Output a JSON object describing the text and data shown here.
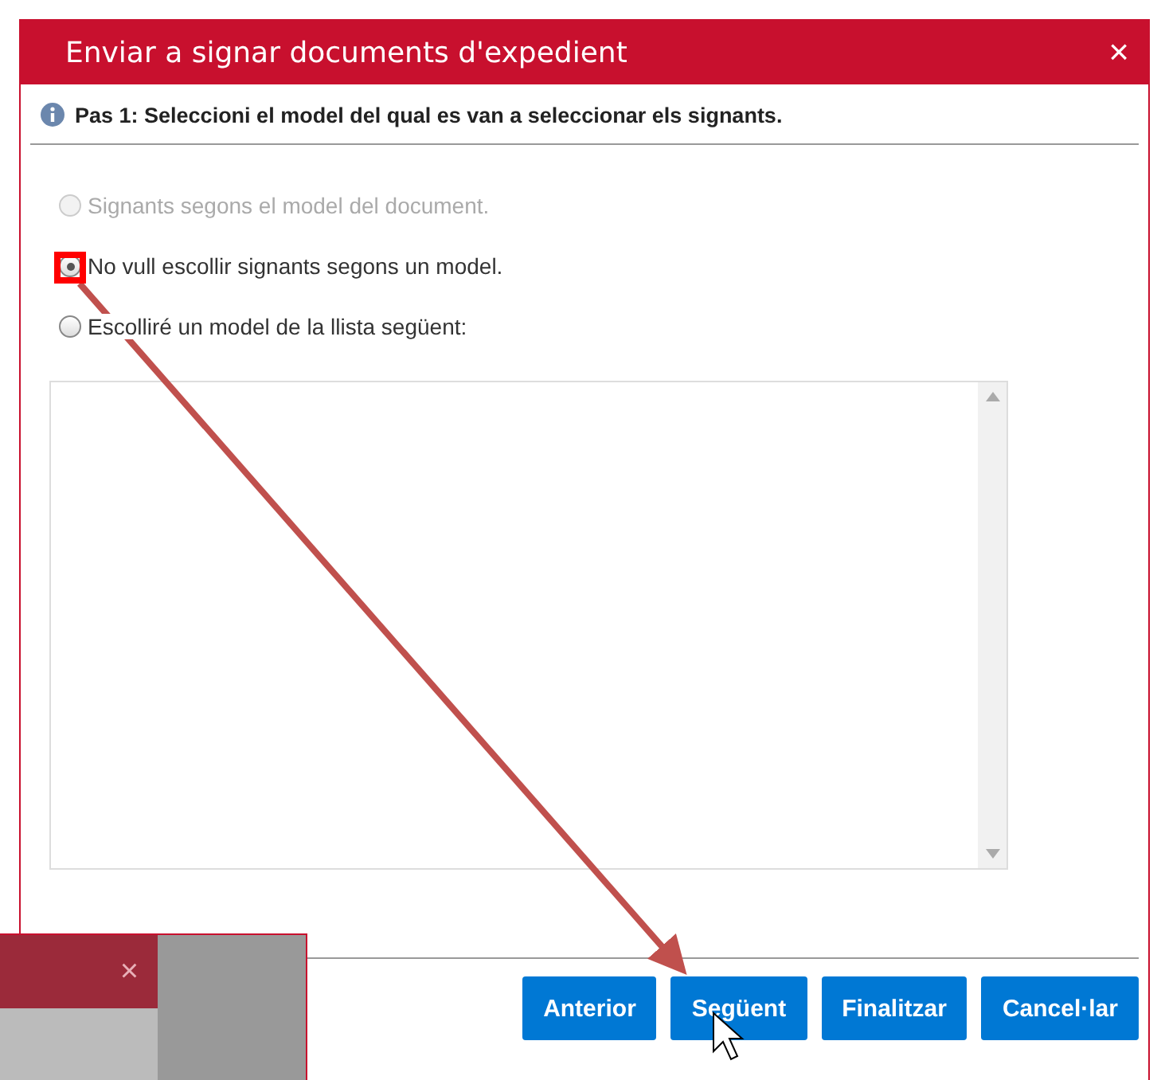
{
  "dialog": {
    "title": "Enviar a signar documents d'expedient",
    "close": "×",
    "step": "Pas 1: Seleccioni el model del qual es van a seleccionar els signants.",
    "options": [
      {
        "label": "Signants segons el model del document.",
        "selected": false,
        "disabled": true
      },
      {
        "label": "No vull escollir signants segons un model.",
        "selected": true,
        "disabled": false
      },
      {
        "label": "Escolliré un model de la llista següent:",
        "selected": false,
        "disabled": false
      }
    ],
    "buttons": [
      "Anterior",
      "Següent",
      "Finalitzar",
      "Cancel·lar"
    ]
  },
  "inset_window": {
    "close": "×"
  }
}
